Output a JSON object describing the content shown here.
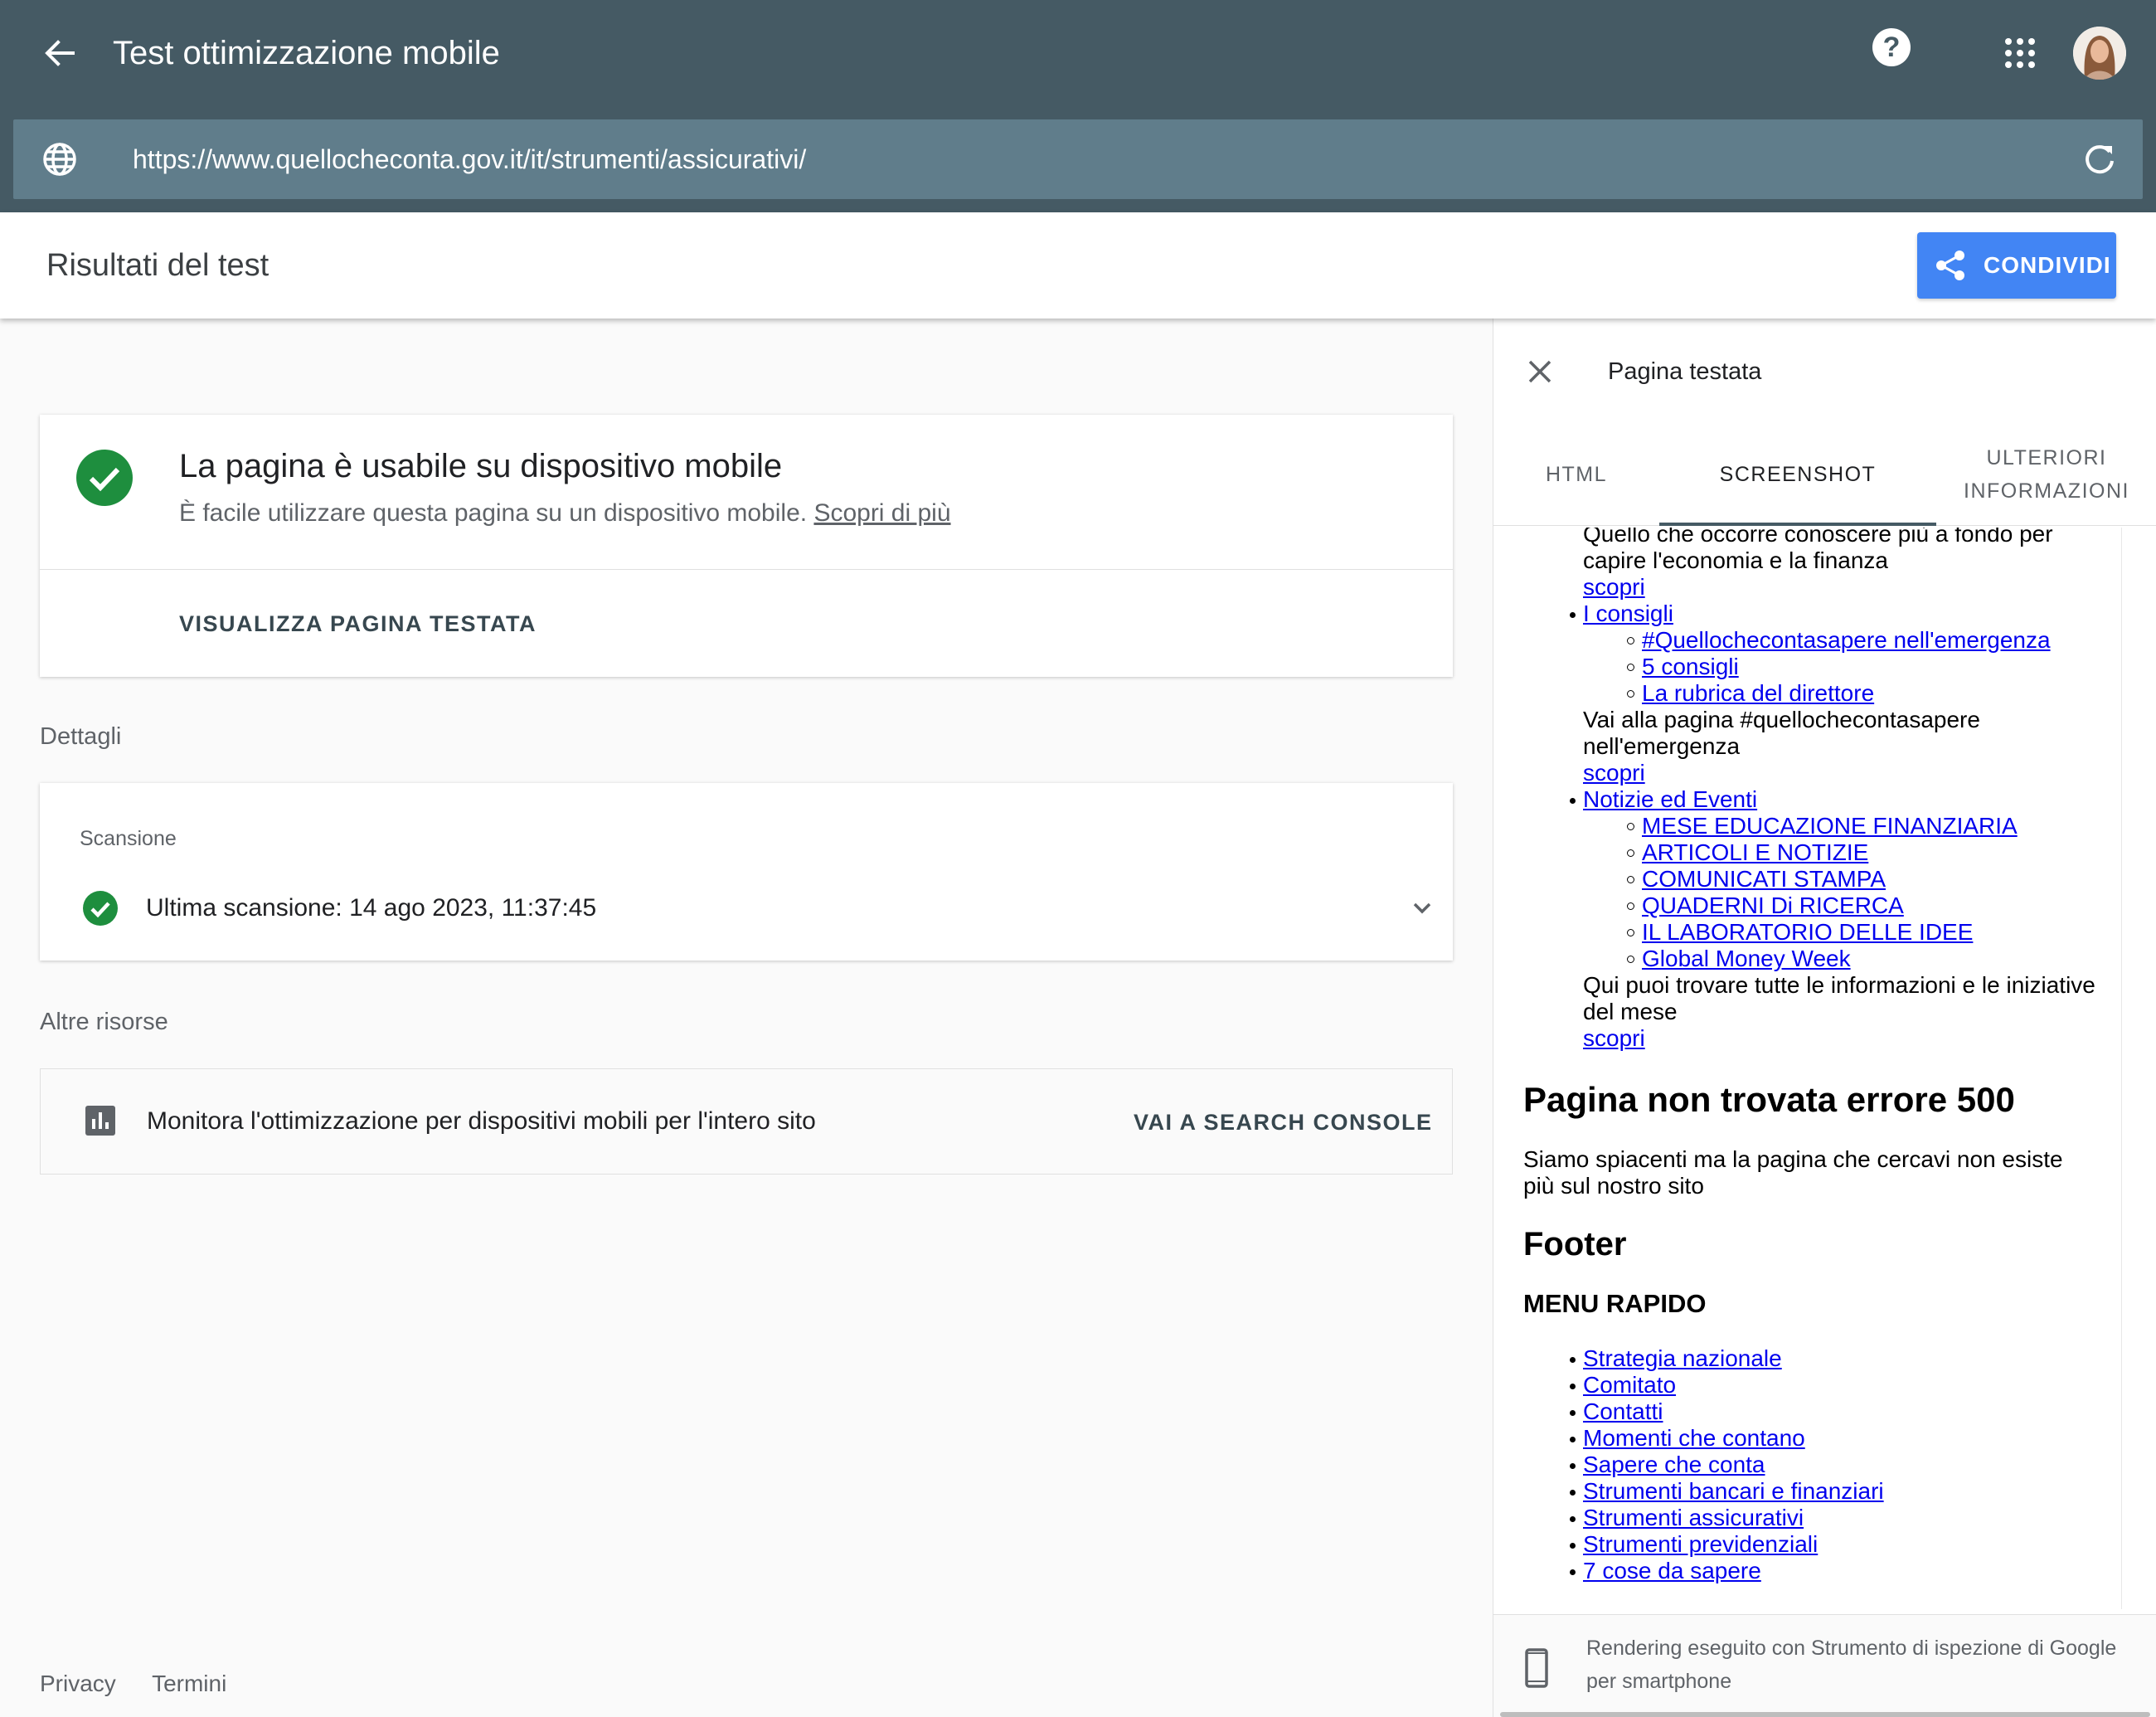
{
  "app": {
    "title": "Test ottimizzazione mobile",
    "url": "https://www.quellocheconta.gov.it/it/strumenti/assicurativi/"
  },
  "header": {
    "title": "Risultati del test",
    "share_label": "CONDIVIDI"
  },
  "result": {
    "title": "La pagina è usabile su dispositivo mobile",
    "subtitle": "È facile utilizzare questa pagina su un dispositivo mobile.",
    "learn_more": "Scopri di più",
    "view_tested": "VISUALIZZA PAGINA TESTATA"
  },
  "details": {
    "section": "Dettagli",
    "scan_label": "Scansione",
    "last_scan": "Ultima scansione: 14 ago 2023, 11:37:45"
  },
  "resources": {
    "section": "Altre risorse",
    "text": "Monitora l'ottimizzazione per dispositivi mobili per l'intero sito",
    "button": "VAI A SEARCH CONSOLE"
  },
  "footer": {
    "privacy": "Privacy",
    "terms": "Termini"
  },
  "panel": {
    "title": "Pagina testata",
    "tabs": [
      "HTML",
      "SCREENSHOT",
      "ULTERIORI INFORMAZIONI"
    ],
    "active_tab": "SCREENSHOT",
    "render_note": "Rendering eseguito con Strumento di ispezione di Google per smartphone"
  },
  "screenshot": {
    "intro": [
      "Quello che occorre conoscere più a fondo per",
      "capire l'economia e la finanza"
    ],
    "scopri": "scopri",
    "consigli": {
      "label": "I consigli",
      "items": [
        "#Quellochecontasapere nell'emergenza",
        "5 consigli",
        "La rubrica del direttore"
      ],
      "desc": [
        "Vai alla pagina #quellochecontasapere",
        "nell'emergenza"
      ]
    },
    "notizie": {
      "label": "Notizie ed Eventi",
      "items": [
        "MESE EDUCAZIONE FINANZIARIA",
        "ARTICOLI E NOTIZIE",
        "COMUNICATI STAMPA",
        "QUADERNI Di RICERCA",
        "IL LABORATORIO DELLE IDEE",
        "Global Money Week"
      ],
      "desc": [
        "Qui puoi trovare tutte le informazioni e le iniziative",
        "del mese"
      ]
    },
    "error_title": "Pagina non trovata errore 500",
    "error_text": [
      "Siamo spiacenti ma la pagina che cercavi non esiste",
      "più sul nostro sito"
    ],
    "footer_title": "Footer",
    "menu_title": "MENU RAPIDO",
    "menu_items": [
      "Strategia nazionale",
      "Comitato",
      "Contatti",
      "Momenti che contano",
      "Sapere che conta",
      "Strumenti bancari e finanziari",
      "Strumenti assicurativi",
      "Strumenti previdenziali",
      "7 cose da sapere"
    ]
  },
  "colors": {
    "topbar": "#455a64",
    "urlbar": "#607d8b",
    "accent": "#4285f4",
    "success": "#1e8e3e",
    "link": "#0000ee"
  },
  "icons": [
    "back-arrow-icon",
    "help-icon",
    "apps-icon",
    "avatar",
    "globe-icon",
    "reload-icon",
    "share-icon",
    "check-circle-icon",
    "chevron-down-icon",
    "bar-chart-icon",
    "close-icon",
    "smartphone-icon"
  ]
}
